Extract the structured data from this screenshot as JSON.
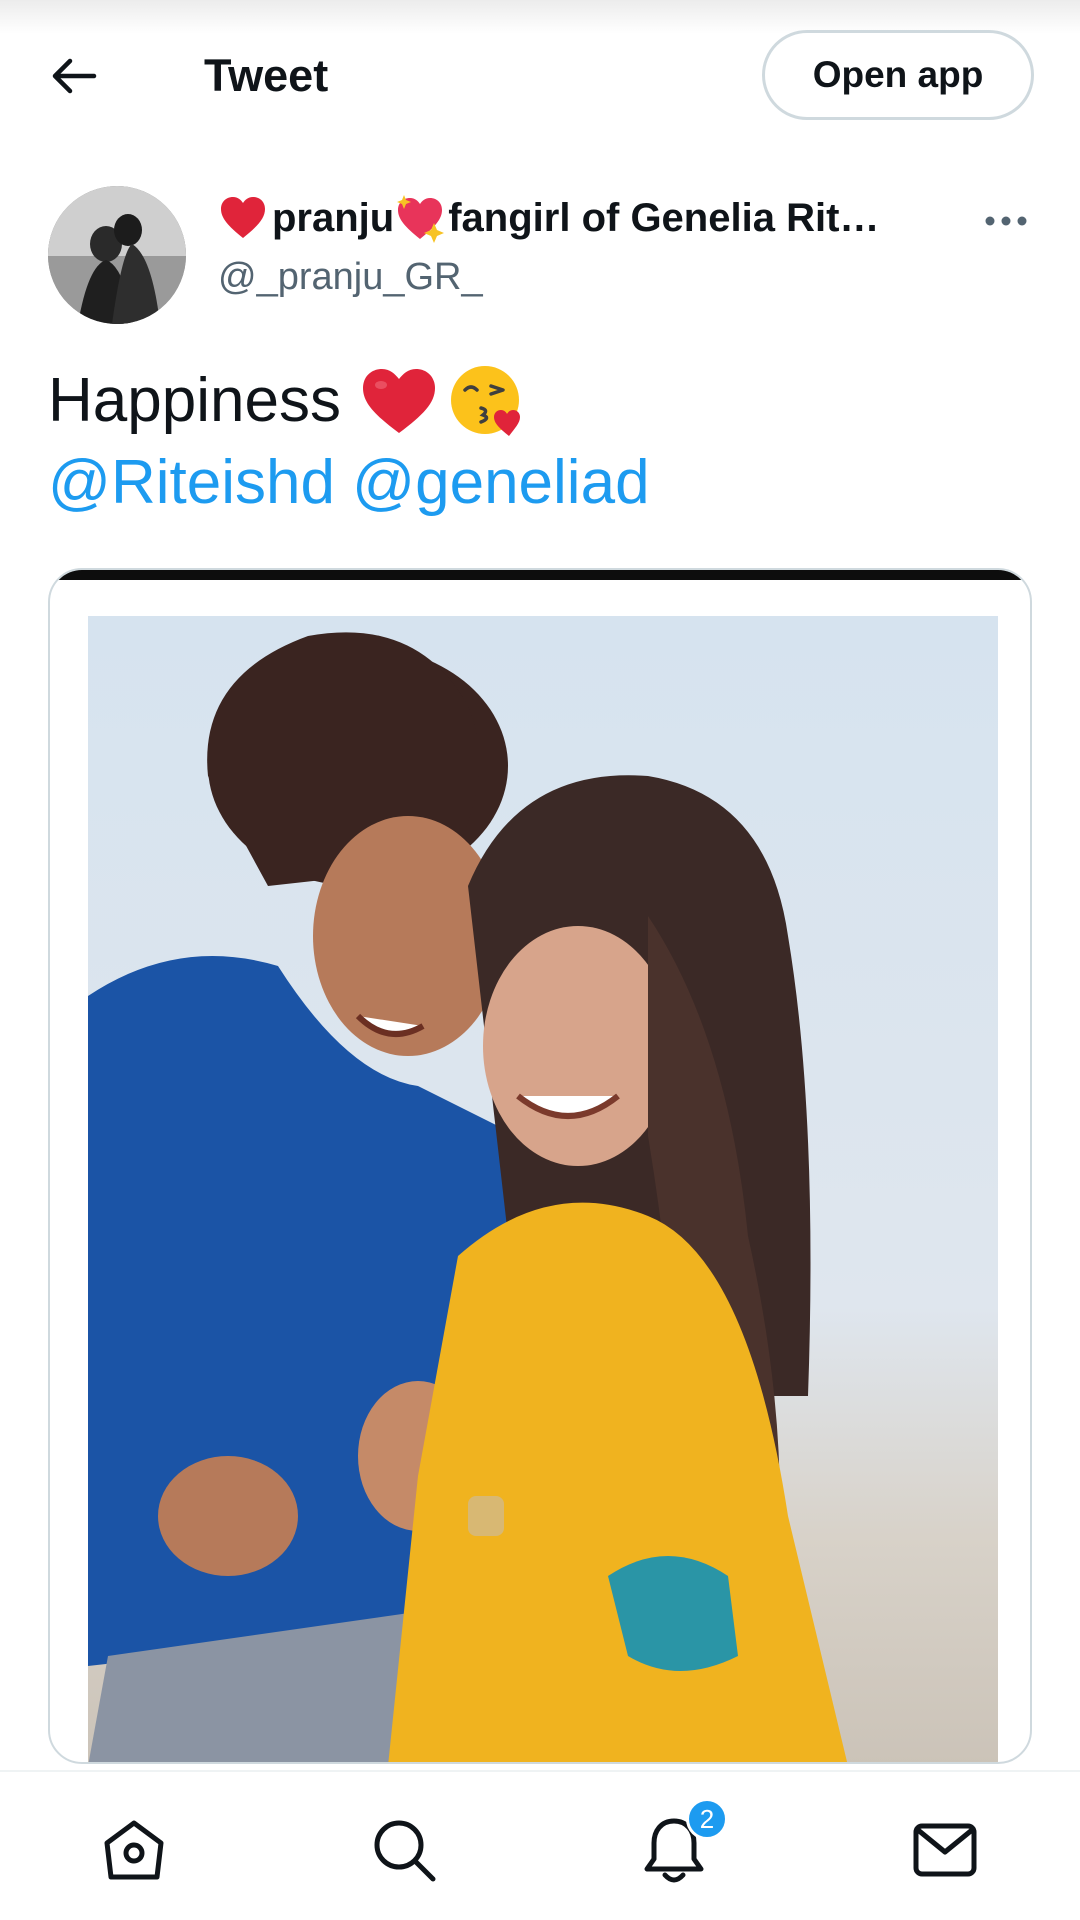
{
  "header": {
    "title": "Tweet",
    "open_app_label": "Open app"
  },
  "author": {
    "name_part1": "pranju",
    "name_part2": "fangirl of Genelia Rit…",
    "handle": "@_pranju_GR_"
  },
  "tweet": {
    "text": "Happiness",
    "mentions": [
      "@Riteishd",
      "@geneliad"
    ]
  },
  "media": {
    "alt": "Photo"
  },
  "nav": {
    "notifications_badge": "2"
  },
  "colors": {
    "accent": "#1d9bf0",
    "text": "#0f1419",
    "secondary": "#536471",
    "border": "#cfd9de",
    "heart": "#e0243a"
  },
  "icons": {
    "back": "arrow-left-icon",
    "more": "more-horizontal-icon",
    "home": "home-icon",
    "search": "search-icon",
    "notifications": "bell-icon",
    "messages": "mail-icon"
  }
}
